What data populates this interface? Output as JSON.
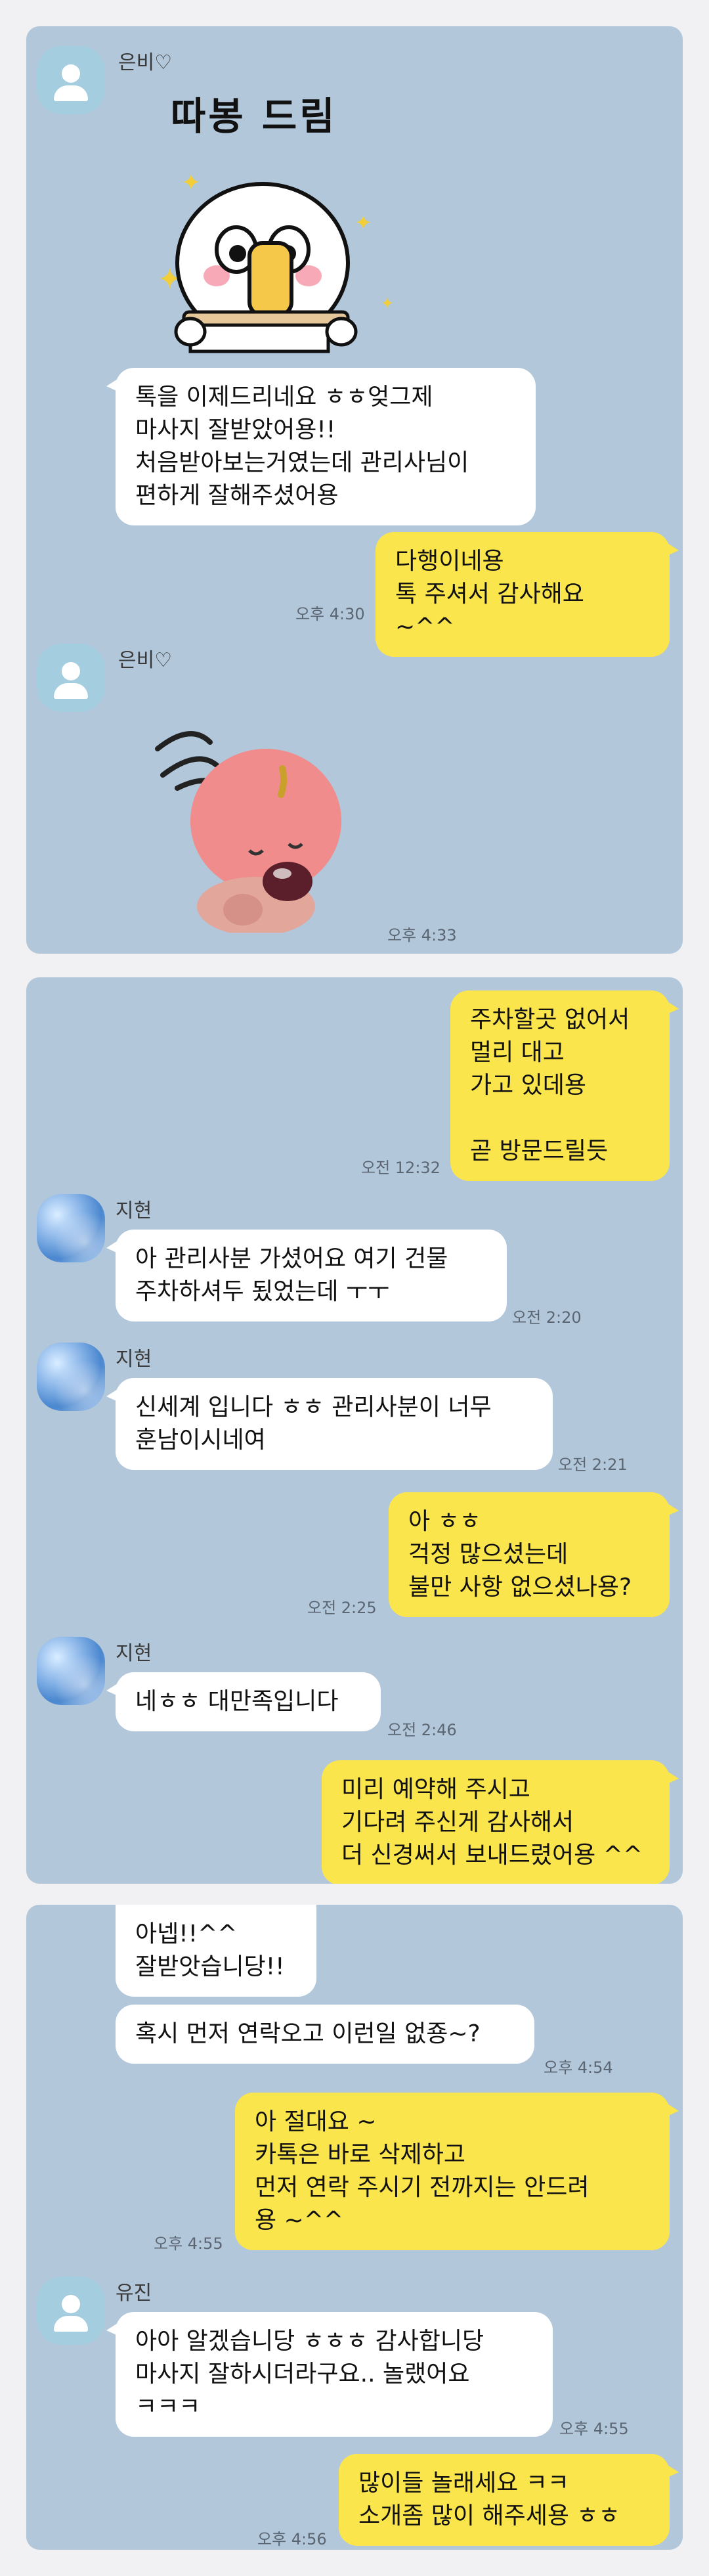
{
  "panel1": {
    "sender": "은비♡",
    "sticker1_text": "따봉 드림",
    "msg1": "톡을 이제드리네요 ㅎㅎ엊그제\n마사지 잘받았어용!!\n처음받아보는거였는데 관리사님이\n편하게 잘해주셨어용",
    "reply": "다행이네용\n톡 주셔서 감사해요 ~^^",
    "reply_time": "오후 4:30",
    "sender2": "은비♡",
    "sticker2_time": "오후 4:33"
  },
  "panel2": {
    "out1": "주차할곳 없어서\n멀리 대고\n가고 있데용\n\n곧 방문드릴듯",
    "out1_time": "오전 12:32",
    "sender": "지현",
    "in1": "아 관리사분 가셨어요 여기 건물\n주차하셔두 됬었는데 ㅜㅜ",
    "in1_time": "오전 2:20",
    "sender2": "지현",
    "in2": "신세계 입니다 ㅎㅎ 관리사분이 너무\n훈남이시네여",
    "in2_time": "오전 2:21",
    "out2": "아 ㅎㅎ\n걱정 많으셨는데\n불만 사항 없으셨나용?",
    "out2_time": "오전 2:25",
    "sender3": "지현",
    "in3": "네ㅎㅎ 대만족입니다",
    "in3_time": "오전 2:46",
    "out3": "미리 예약해 주시고\n기다려 주신게 감사해서\n더 신경써서 보내드렸어용 ^^"
  },
  "panel3": {
    "in1": "아넵!!^^\n잘받앗습니당!!",
    "in2": "혹시 먼저 연락오고 이런일 없죵~?",
    "in2_time": "오후 4:54",
    "out1": "아 절대요 ~\n카톡은 바로 삭제하고\n먼저 연락 주시기 전까지는 안드려\n용 ~^^",
    "out1_time": "오후 4:55",
    "sender": "유진",
    "in3": "아아 알겠습니당 ㅎㅎㅎ 감사합니당\n마사지 잘하시더라구요.. 놀랬어요\nㅋㅋㅋ",
    "in3_time": "오후 4:55",
    "out2": "많이들 놀래세요 ㅋㅋ\n소개좀 많이 해주세용 ㅎㅎ",
    "out2_time": "오후 4:56"
  },
  "colors": {
    "chat_bg": "#b2c7da",
    "page_bg": "#f1f1f3",
    "out_bubble": "#fbe54d",
    "in_bubble": "#ffffff"
  }
}
